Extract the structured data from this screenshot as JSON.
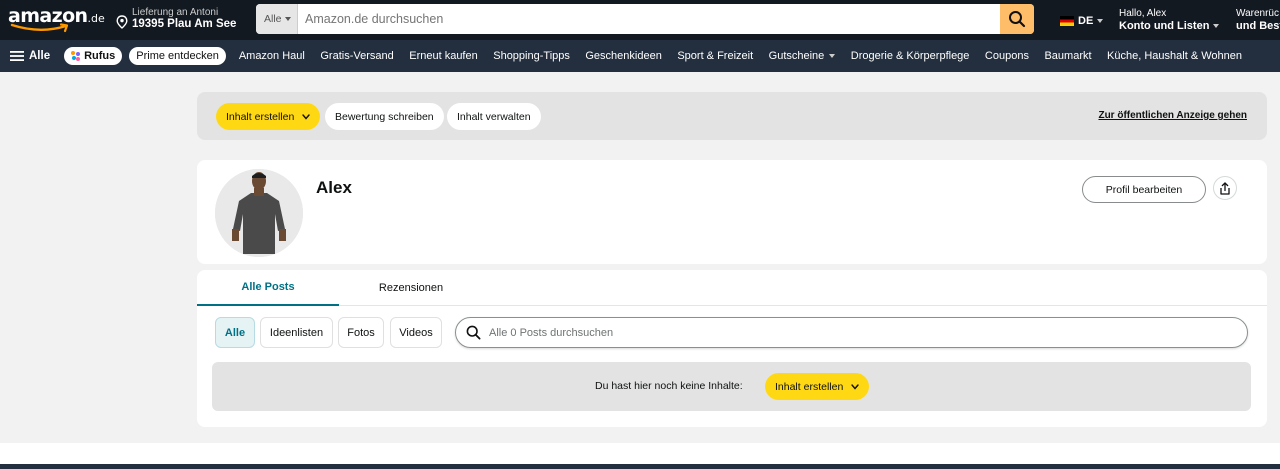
{
  "header": {
    "logo_text": "amazon",
    "logo_tld": ".de",
    "delivery_line1": "Lieferung an Antoni",
    "delivery_line2": "19395 Plau Am See",
    "search_category": "Alle",
    "search_placeholder": "Amazon.de durchsuchen",
    "language": "DE",
    "greeting": "Hallo, Alex",
    "account_label": "Konto und Listen",
    "returns_line1": "Warenrüc",
    "returns_line2": "und Best"
  },
  "subnav": {
    "all_label": "Alle",
    "rufus_label": "Rufus",
    "prime_label": "Prime entdecken",
    "items": [
      "Amazon Haul",
      "Gratis-Versand",
      "Erneut kaufen",
      "Shopping-Tipps",
      "Geschenkideen",
      "Sport & Freizeit",
      "Gutscheine",
      "Drogerie & Körperpflege",
      "Coupons",
      "Baumarkt",
      "Küche, Haushalt & Wohnen"
    ]
  },
  "actions": {
    "create_label": "Inhalt erstellen",
    "review_label": "Bewertung schreiben",
    "manage_label": "Inhalt verwalten",
    "public_link": "Zur öffentlichen Anzeige gehen"
  },
  "profile": {
    "name": "Alex",
    "edit_label": "Profil bearbeiten"
  },
  "posts": {
    "tabs": [
      "Alle Posts",
      "Rezensionen"
    ],
    "filters": [
      "Alle",
      "Ideenlisten",
      "Fotos",
      "Videos"
    ],
    "search_placeholder": "Alle 0 Posts durchsuchen",
    "empty_text": "Du hast hier noch keine Inhalte:",
    "empty_button": "Inhalt erstellen"
  },
  "colors": {
    "nav_dark": "#131921",
    "subnav": "#232f3e",
    "accent_yellow": "#ffd814",
    "search_button": "#febd69",
    "teal": "#007185"
  }
}
